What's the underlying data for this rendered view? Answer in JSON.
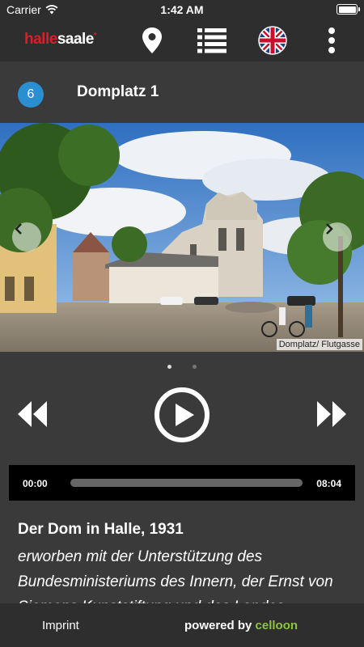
{
  "status_bar": {
    "carrier": "Carrier",
    "time": "1:42 AM",
    "battery_level": 1.0
  },
  "toolbar": {
    "logo": {
      "part1": "halle",
      "part2": "saale",
      "mark": "*"
    },
    "icons": [
      "map-pin-icon",
      "list-icon",
      "uk-flag-icon",
      "more-vertical-icon"
    ]
  },
  "stop": {
    "number": "6",
    "title": "Domplatz 1"
  },
  "photo": {
    "caption": "Domplatz/ Flutgasse",
    "page_count": 2,
    "current_page": 1
  },
  "player": {
    "current_time": "00:00",
    "duration": "08:04",
    "progress": 0.0
  },
  "description": {
    "heading": "Der Dom in Halle, 1931",
    "body": "erworben mit der Unterstützung des Bundesministeriums des Innern, der Ernst von Siemens Kunststiftung und des Landes"
  },
  "footer": {
    "imprint": "Imprint",
    "powered_by": "powered by",
    "brand": "celloon",
    "brand_color": "#8cc63f"
  }
}
